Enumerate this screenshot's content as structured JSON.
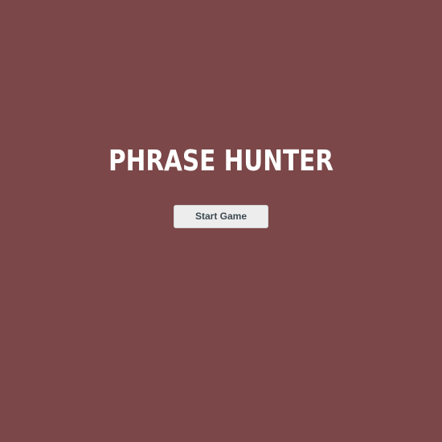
{
  "overlay": {
    "title": "PHRASE HUNTER",
    "start_button_label": "Start Game",
    "background_color": "#7b4748",
    "title_color": "#ffffff",
    "button_color": "#ededed",
    "button_text_color": "#3d4a52"
  }
}
